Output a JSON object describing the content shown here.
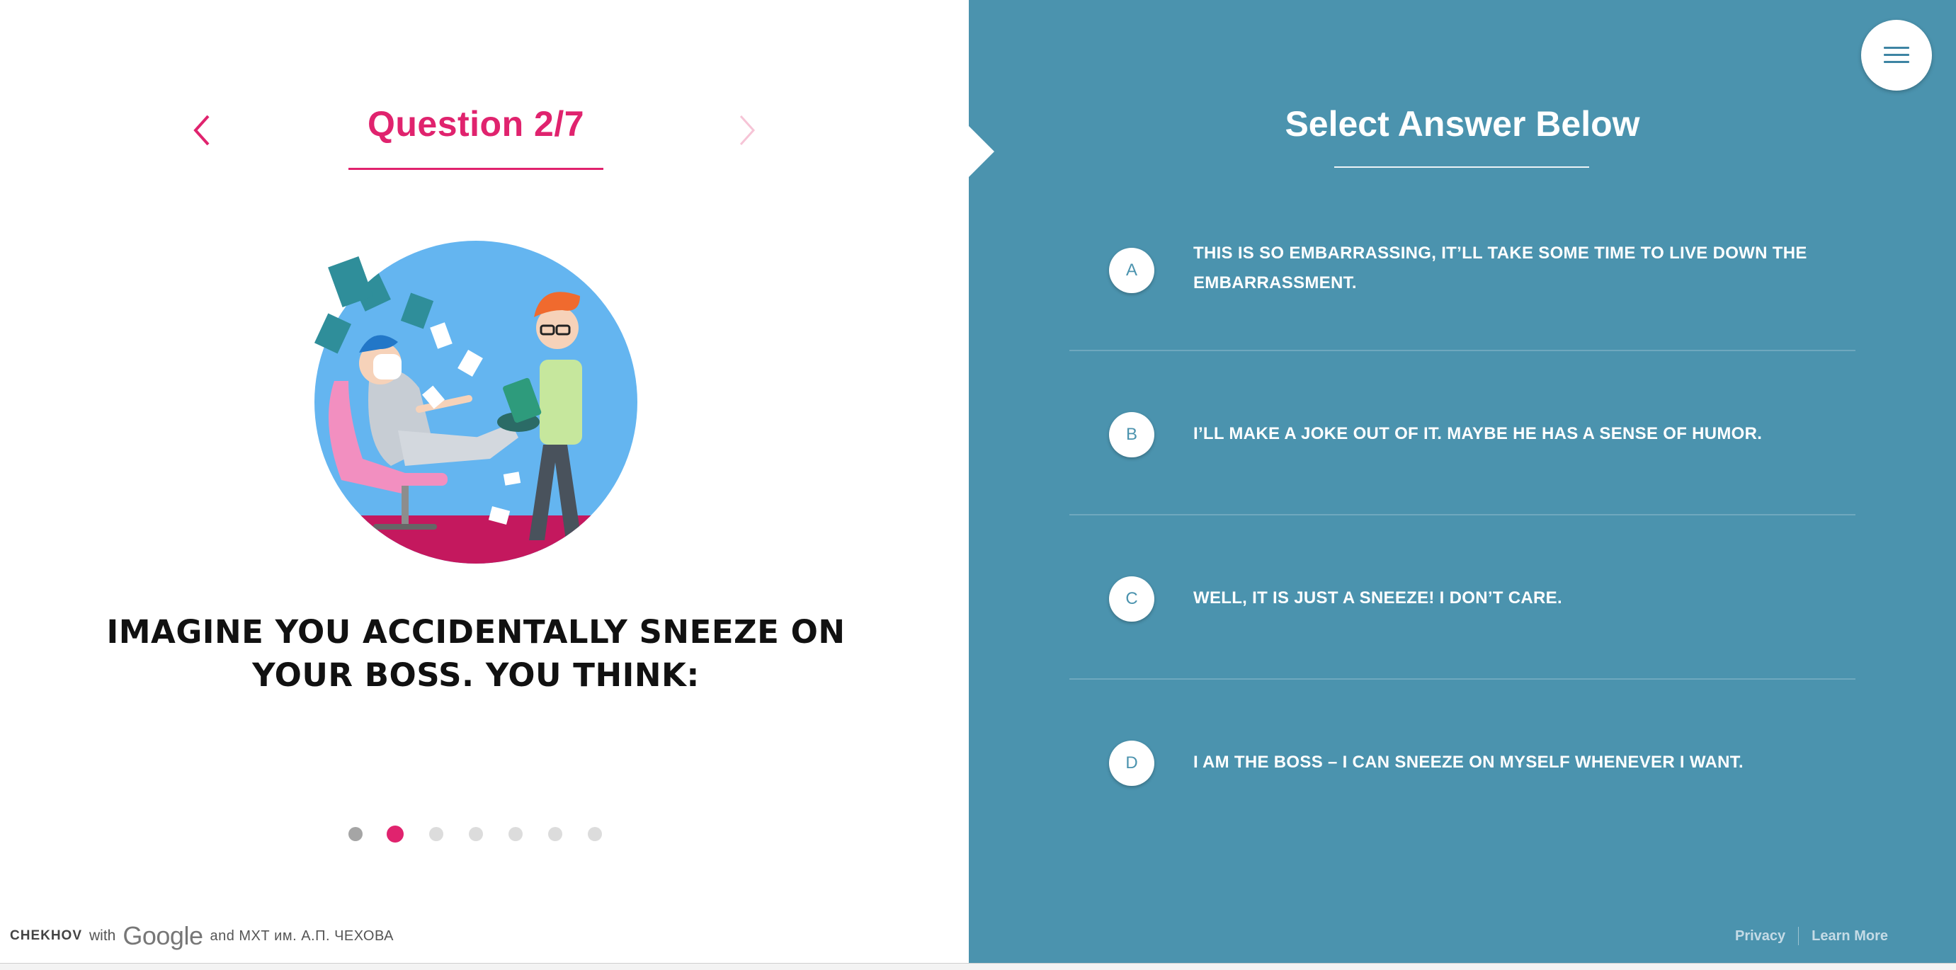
{
  "question_panel": {
    "title": "Question 2/7",
    "question_text": "IMAGINE YOU ACCIDENTALLY SNEEZE ON YOUR BOSS. YOU THINK:",
    "progress": {
      "total": 7,
      "current": 2
    }
  },
  "answer_panel": {
    "title": "Select Answer Below",
    "answers": [
      {
        "letter": "A",
        "text": "THIS IS SO EMBARRASSING, IT’LL TAKE SOME TIME TO LIVE DOWN THE EMBARRASSMENT."
      },
      {
        "letter": "B",
        "text": "I’LL MAKE A JOKE OUT OF IT. MAYBE HE HAS A SENSE OF HUMOR."
      },
      {
        "letter": "C",
        "text": "WELL, IT IS JUST A SNEEZE! I DON’T CARE."
      },
      {
        "letter": "D",
        "text": "I AM THE BOSS – I CAN SNEEZE ON MYSELF WHENEVER I WANT."
      }
    ]
  },
  "footer_left": {
    "brand": "CHEKHOV",
    "with": "with",
    "google": "Google",
    "partner": "and МХТ им. А.П. ЧЕХОВА"
  },
  "footer_right": {
    "privacy": "Privacy",
    "learn_more": "Learn More"
  },
  "icons": {
    "prev": "chevron-left-icon",
    "next": "chevron-right-icon",
    "menu": "hamburger-menu-icon"
  },
  "colors": {
    "accent": "#e0236e",
    "panel": "#4b93ae",
    "text_dark": "#111111"
  }
}
